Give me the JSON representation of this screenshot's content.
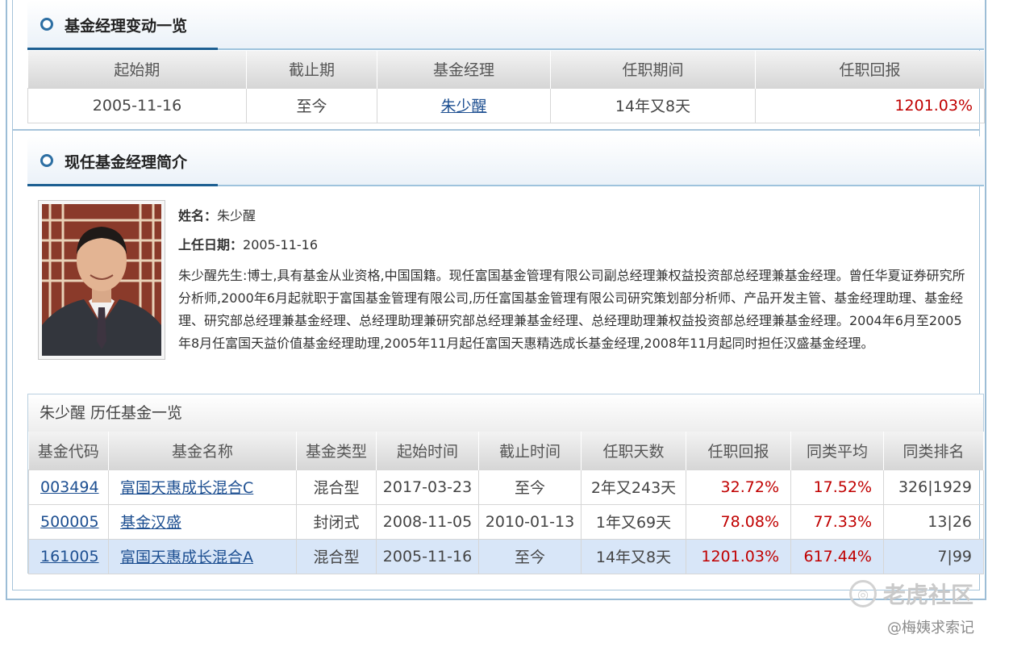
{
  "section1": {
    "title": "基金经理变动一览",
    "headers": [
      "起始期",
      "截止期",
      "基金经理",
      "任职期间",
      "任职回报"
    ],
    "row": {
      "start": "2005-11-16",
      "end": "至今",
      "manager": "朱少醒",
      "duration": "14年又8天",
      "return": "1201.03%"
    }
  },
  "section2": {
    "title": "现任基金经理简介",
    "name_label": "姓名：",
    "name": "朱少醒",
    "date_label": "上任日期：",
    "date": "2005-11-16",
    "bio": "朱少醒先生:博士,具有基金从业资格,中国国籍。现任富国基金管理有限公司副总经理兼权益投资部总经理兼基金经理。曾任华夏证券研究所分析师,2000年6月起就职于富国基金管理有限公司,历任富国基金管理有限公司研究策划部分析师、产品开发主管、基金经理助理、基金经理、研究部总经理兼基金经理、总经理助理兼研究部总经理兼基金经理、总经理助理兼权益投资部总经理兼基金经理。2004年6月至2005年8月任富国天益价值基金经理助理,2005年11月起任富国天惠精选成长基金经理,2008年11月起同时担任汉盛基金经理。"
  },
  "history": {
    "title": "朱少醒 历任基金一览",
    "headers": [
      "基金代码",
      "基金名称",
      "基金类型",
      "起始时间",
      "截止时间",
      "任职天数",
      "任职回报",
      "同类平均",
      "同类排名"
    ],
    "rows": [
      {
        "code": "003494",
        "name": "富国天惠成长混合C",
        "type": "混合型",
        "start": "2017-03-23",
        "end": "至今",
        "days": "2年又243天",
        "return": "32.72%",
        "avg": "17.52%",
        "rank": "326|1929"
      },
      {
        "code": "500005",
        "name": "基金汉盛",
        "type": "封闭式",
        "start": "2008-11-05",
        "end": "2010-01-13",
        "days": "1年又69天",
        "return": "78.08%",
        "avg": "77.33%",
        "rank": "13|26"
      },
      {
        "code": "161005",
        "name": "富国天惠成长混合A",
        "type": "混合型",
        "start": "2005-11-16",
        "end": "至今",
        "days": "14年又8天",
        "return": "1201.03%",
        "avg": "617.44%",
        "rank": "7|99"
      }
    ]
  },
  "watermark": {
    "brand": "老虎社区",
    "icon": "tiger-logo-icon",
    "author": "@梅姨求索记"
  },
  "colors": {
    "return_red": "#c00000",
    "link_blue": "#1d4f91",
    "accent_blue": "#1d5f92",
    "highlight_row": "#d8e6f8"
  }
}
